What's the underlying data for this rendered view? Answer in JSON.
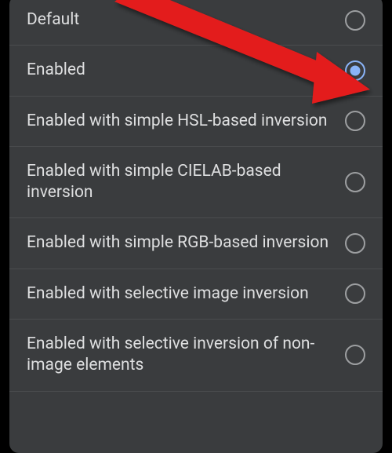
{
  "options": [
    {
      "label": "Default",
      "selected": false
    },
    {
      "label": "Enabled",
      "selected": true
    },
    {
      "label": "Enabled with simple HSL-based inversion",
      "selected": false
    },
    {
      "label": "Enabled with simple CIELAB-based inversion",
      "selected": false
    },
    {
      "label": "Enabled with simple RGB-based inversion",
      "selected": false
    },
    {
      "label": "Enabled with selective image inversion",
      "selected": false
    },
    {
      "label": "Enabled with selective inversion of non-image elements",
      "selected": false
    }
  ],
  "annotation": {
    "arrow_color": "#e31b1b"
  }
}
